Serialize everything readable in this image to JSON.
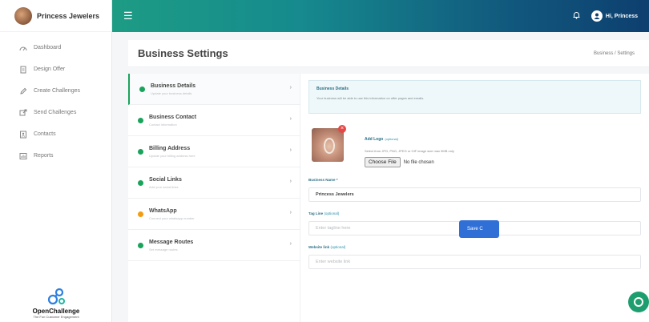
{
  "sidebar": {
    "brand_name": "Princess Jewelers",
    "items": [
      {
        "label": "Dashboard",
        "icon": "dashboard-icon"
      },
      {
        "label": "Design Offer",
        "icon": "document-icon"
      },
      {
        "label": "Create Challenges",
        "icon": "edit-icon"
      },
      {
        "label": "Send Challenges",
        "icon": "send-icon"
      },
      {
        "label": "Contacts",
        "icon": "contacts-icon"
      },
      {
        "label": "Reports",
        "icon": "reports-icon"
      }
    ],
    "logo_name": "OpenChallenge",
    "logo_tagline": "The Fun Customer Engagement"
  },
  "topbar": {
    "greeting": "Hi, Princess"
  },
  "header": {
    "title": "Business Settings",
    "breadcrumb": "Business / Settings"
  },
  "tabs": [
    {
      "label": "Business Details",
      "sub": "Update your business details",
      "status": "green"
    },
    {
      "label": "Business Contact",
      "sub": "Contact information",
      "status": "green"
    },
    {
      "label": "Billing Address",
      "sub": "Update your billing address here",
      "status": "green"
    },
    {
      "label": "Social Links",
      "sub": "Add your social links",
      "status": "green"
    },
    {
      "label": "WhatsApp",
      "sub": "Connect your whatsapp number",
      "status": "orange"
    },
    {
      "label": "Message Routes",
      "sub": "Set message routes",
      "status": "green"
    }
  ],
  "form": {
    "notice_title": "Business Details",
    "notice_text": "Your business will be able to use this information on offer pages and emails.",
    "logo_label": "Add Logo",
    "logo_optional": "(optional)",
    "logo_hint": "Select from JPG, PNG, JPEG or GIF image size max 5MB only",
    "choose_file_label": "Choose File",
    "no_file_text": "No file chosen",
    "business_name_label": "Business Name *",
    "business_name_value": "Princess Jewelers",
    "tagline_label": "Tag Line",
    "tagline_optional": "(optional)",
    "tagline_placeholder": "Enter tagline here",
    "website_label": "Website link",
    "website_optional": "(optional)",
    "website_placeholder": "Enter website link",
    "save_label": "Save C"
  },
  "colors": {
    "brand_gradient_start": "#1d9c84",
    "brand_gradient_end": "#0d3f6f",
    "status_green": "#19a35b",
    "status_orange": "#f39c12",
    "primary_button": "#2f6fd6"
  }
}
